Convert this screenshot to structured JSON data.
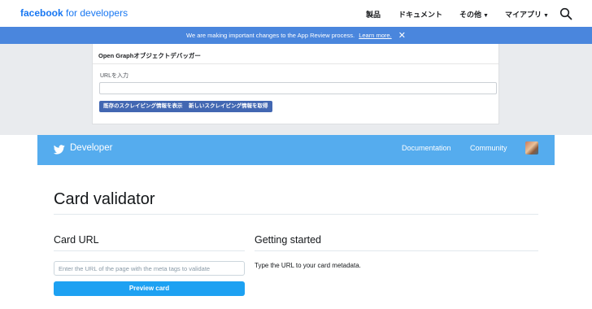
{
  "facebook": {
    "logo_brand": "facebook",
    "logo_rest": "for developers",
    "nav": [
      {
        "label": "製品",
        "dropdown": false
      },
      {
        "label": "ドキュメント",
        "dropdown": false
      },
      {
        "label": "その他",
        "dropdown": true
      },
      {
        "label": "マイアプリ",
        "dropdown": true
      }
    ],
    "search_icon": "search-icon",
    "banner": {
      "text": "We are making important changes to the App Review process.",
      "link": "Learn more.",
      "close_icon": "close-icon"
    },
    "debugger": {
      "title": "Open Graphオブジェクトデバッガー",
      "url_label": "URLを入力",
      "url_value": "",
      "buttons": [
        "既存のスクレイピング情報を表示",
        "新しいスクレイピング情報を取得"
      ]
    },
    "colors": {
      "brand": "#1877f2",
      "banner": "#4a86dd",
      "button": "#4267b2"
    }
  },
  "twitter": {
    "brand": "Developer",
    "bird_icon": "twitter-bird-icon",
    "nav": [
      "Documentation",
      "Community"
    ],
    "avatar_icon": "user-avatar",
    "page_title": "Card validator",
    "card_url": {
      "heading": "Card URL",
      "placeholder": "Enter the URL of the page with the meta tags to validate",
      "value": "",
      "button": "Preview card"
    },
    "getting_started": {
      "heading": "Getting started",
      "text": "Type the URL to your card metadata."
    },
    "colors": {
      "header": "#55acee",
      "button": "#1da1f2"
    }
  }
}
